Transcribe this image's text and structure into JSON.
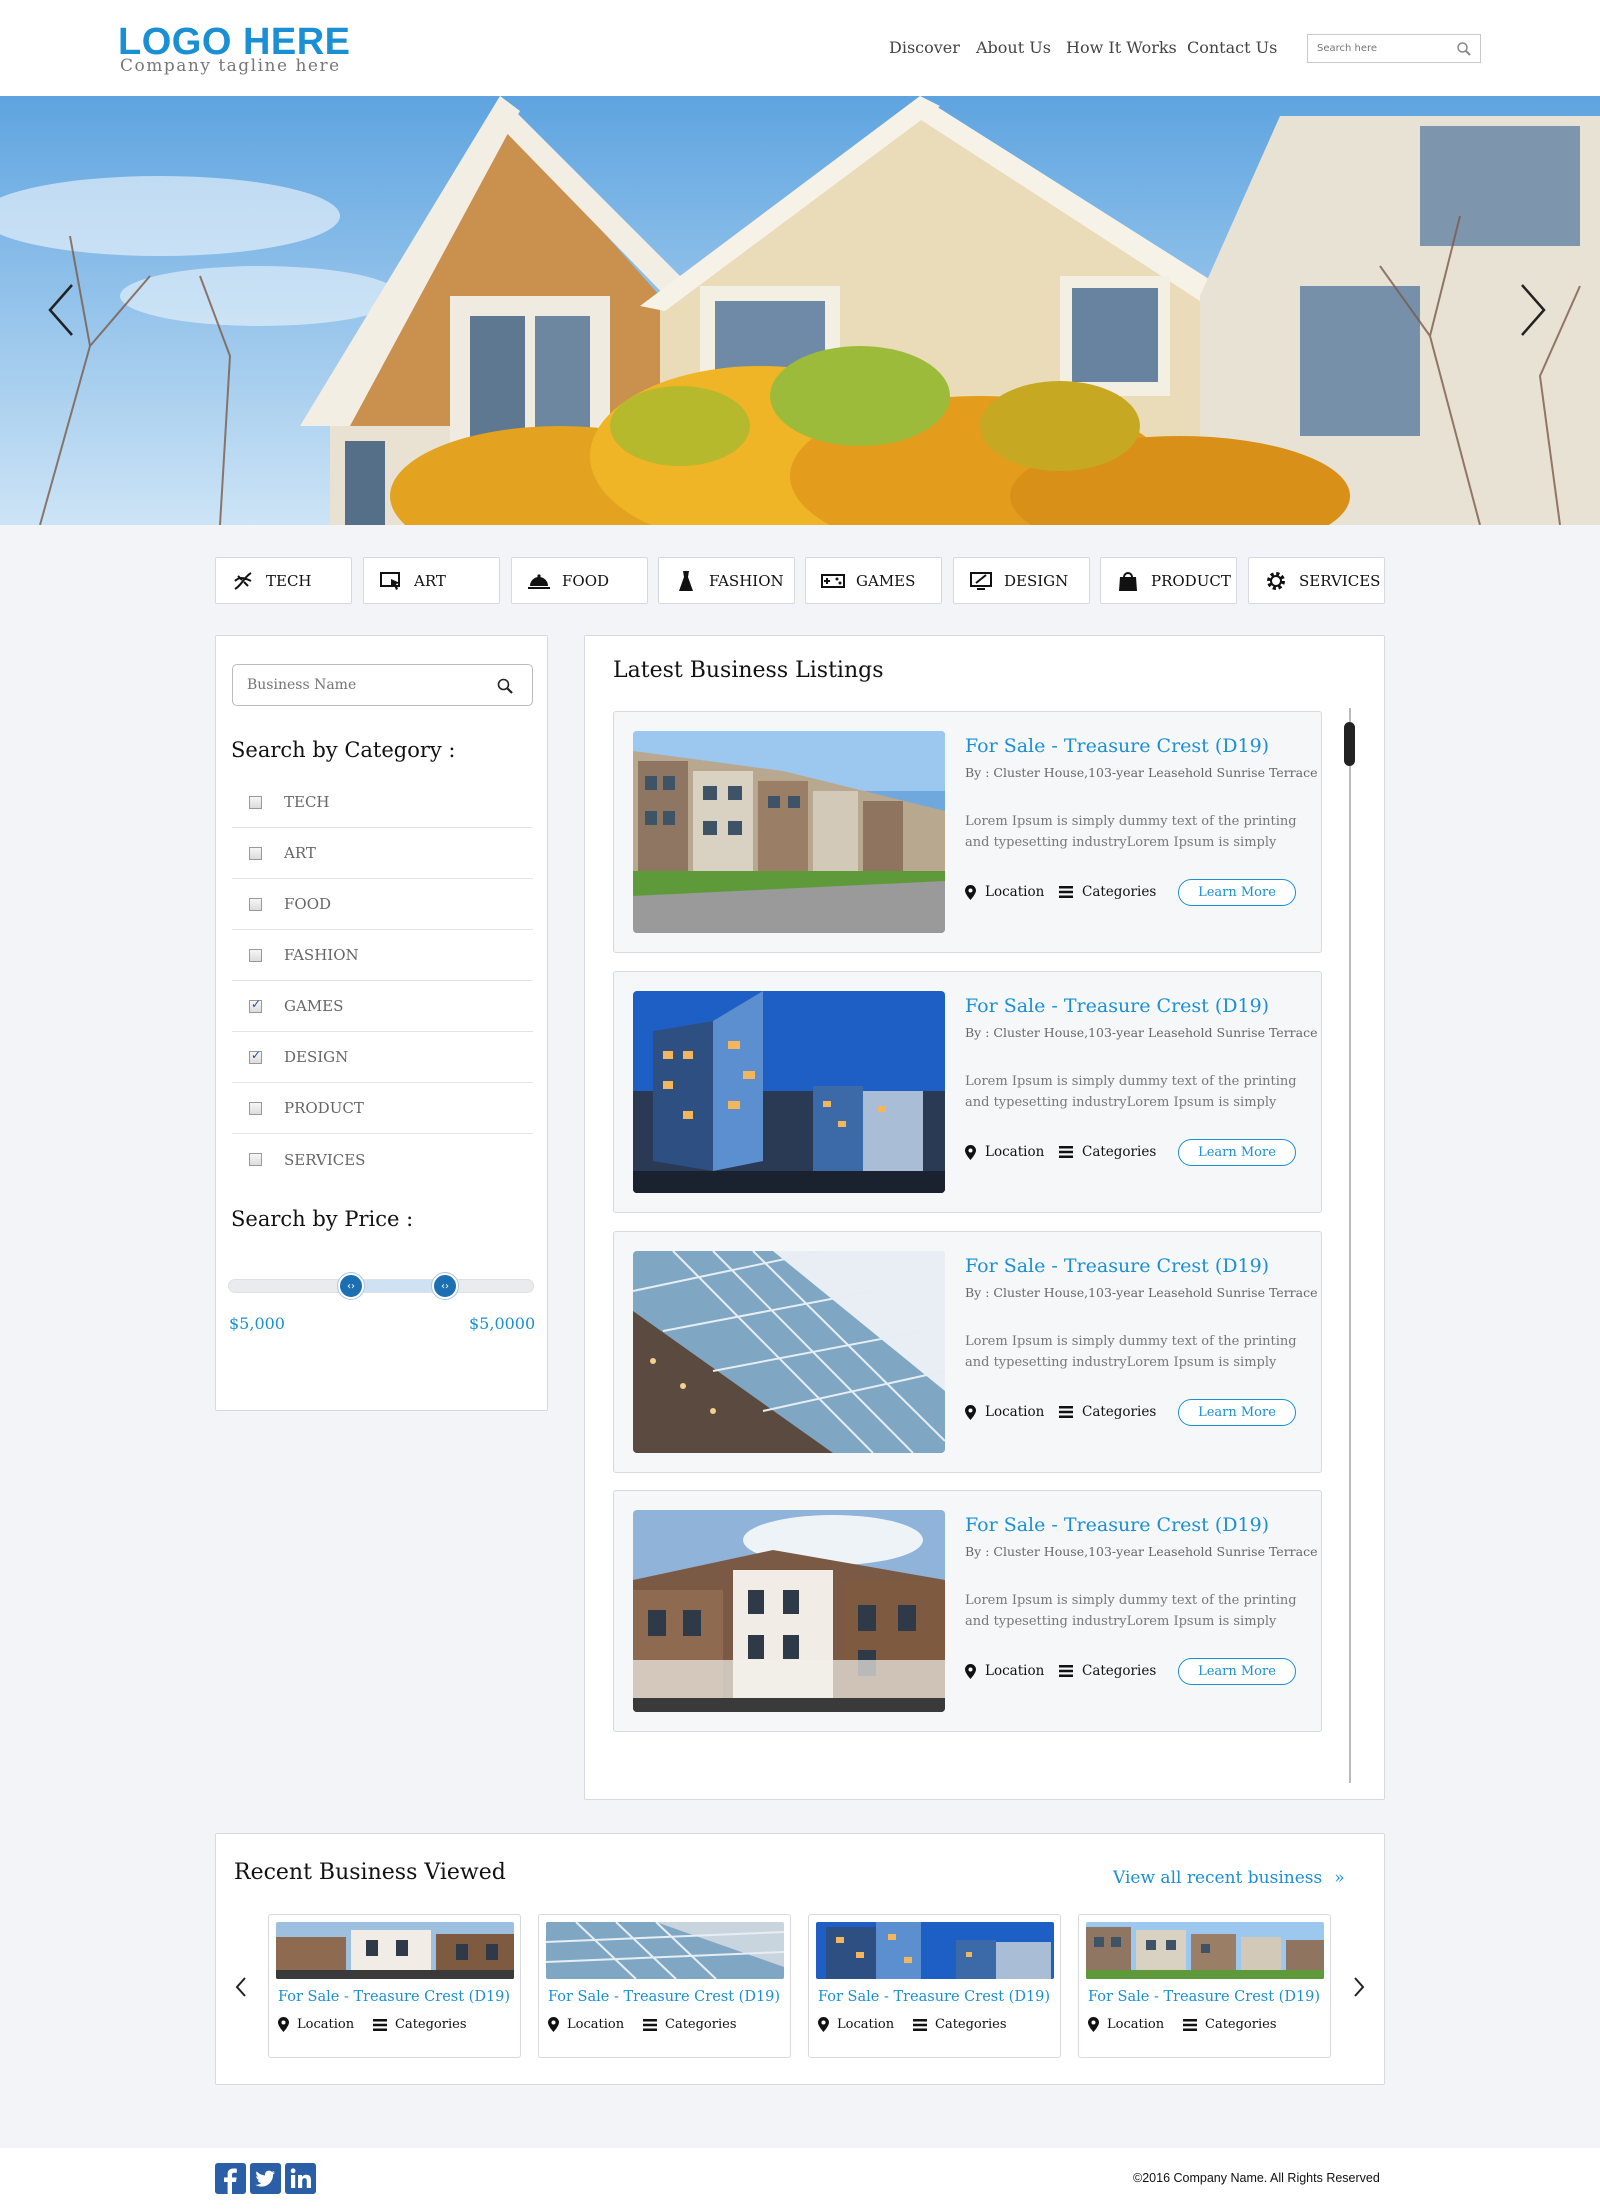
{
  "header": {
    "logo": "LOGO HERE",
    "tagline": "Company tagline here",
    "nav": [
      "Discover",
      "About Us",
      "How It Works",
      "Contact Us"
    ],
    "search_placeholder": "Search here"
  },
  "hero": {
    "prev_icon": "chevron-left-icon",
    "next_icon": "chevron-right-icon"
  },
  "categories": [
    {
      "label": "TECH",
      "icon": "dna-icon"
    },
    {
      "label": "ART",
      "icon": "monitor-cursor-icon"
    },
    {
      "label": "FOOD",
      "icon": "cloche-icon"
    },
    {
      "label": "FASHION",
      "icon": "dress-icon"
    },
    {
      "label": "GAMES",
      "icon": "gamepad-icon"
    },
    {
      "label": "DESIGN",
      "icon": "design-screen-icon"
    },
    {
      "label": "PRODUCT",
      "icon": "bag-icon"
    },
    {
      "label": "SERVICES",
      "icon": "gear-icon"
    }
  ],
  "sidebar": {
    "search_placeholder": "Business Name",
    "category_heading": "Search by Category :",
    "category_filters": [
      {
        "label": "TECH",
        "checked": false
      },
      {
        "label": "ART",
        "checked": false
      },
      {
        "label": "FOOD",
        "checked": false
      },
      {
        "label": "FASHION",
        "checked": false
      },
      {
        "label": "GAMES",
        "checked": true
      },
      {
        "label": "DESIGN",
        "checked": true
      },
      {
        "label": "PRODUCT",
        "checked": false
      },
      {
        "label": "SERVICES",
        "checked": false
      }
    ],
    "price_heading": "Search by Price :",
    "price_min": "$5,000",
    "price_max": "$5,0000"
  },
  "listings": {
    "heading": "Latest Business Listings",
    "items": [
      {
        "title": "For Sale - Treasure Crest (D19)",
        "by": "By : Cluster House,103-year Leasehold Sunrise Terrace",
        "desc_line1": "Lorem Ipsum is simply dummy text of the printing",
        "desc_line2": "and typesetting industryLorem Ipsum is simply",
        "location": "Location",
        "categories": "Categories",
        "cta": "Learn More"
      },
      {
        "title": "For Sale - Treasure Crest (D19)",
        "by": "By : Cluster House,103-year Leasehold Sunrise Terrace",
        "desc_line1": "Lorem Ipsum is simply dummy text of the printing",
        "desc_line2": "and typesetting industryLorem Ipsum is simply",
        "location": "Location",
        "categories": "Categories",
        "cta": "Learn More"
      },
      {
        "title": "For Sale - Treasure Crest (D19)",
        "by": "By : Cluster House,103-year Leasehold Sunrise Terrace",
        "desc_line1": "Lorem Ipsum is simply dummy text of the printing",
        "desc_line2": "and typesetting industryLorem Ipsum is simply",
        "location": "Location",
        "categories": "Categories",
        "cta": "Learn More"
      },
      {
        "title": "For Sale - Treasure Crest (D19)",
        "by": "By : Cluster House,103-year Leasehold Sunrise Terrace",
        "desc_line1": "Lorem Ipsum is simply dummy text of the printing",
        "desc_line2": "and typesetting industryLorem Ipsum is simply",
        "location": "Location",
        "categories": "Categories",
        "cta": "Learn More"
      }
    ]
  },
  "recent": {
    "heading": "Recent Business Viewed",
    "view_all": "View all recent business",
    "view_all_icon": "double-chevron-right-icon",
    "items": [
      {
        "title": "For Sale - Treasure Crest (D19)",
        "location": "Location",
        "categories": "Categories"
      },
      {
        "title": "For Sale - Treasure Crest (D19)",
        "location": "Location",
        "categories": "Categories"
      },
      {
        "title": "For Sale - Treasure Crest (D19)",
        "location": "Location",
        "categories": "Categories"
      },
      {
        "title": "For Sale - Treasure Crest (D19)",
        "location": "Location",
        "categories": "Categories"
      }
    ]
  },
  "footer": {
    "social": [
      "facebook-icon",
      "twitter-icon",
      "linkedin-icon"
    ],
    "copyright": "©2016 Company Name. All Rights Reserved"
  },
  "colors": {
    "accent": "#1a8fd4",
    "knob": "#1c6fb3",
    "social": "#2a5ea6",
    "page_bg": "#f2f4f7"
  }
}
